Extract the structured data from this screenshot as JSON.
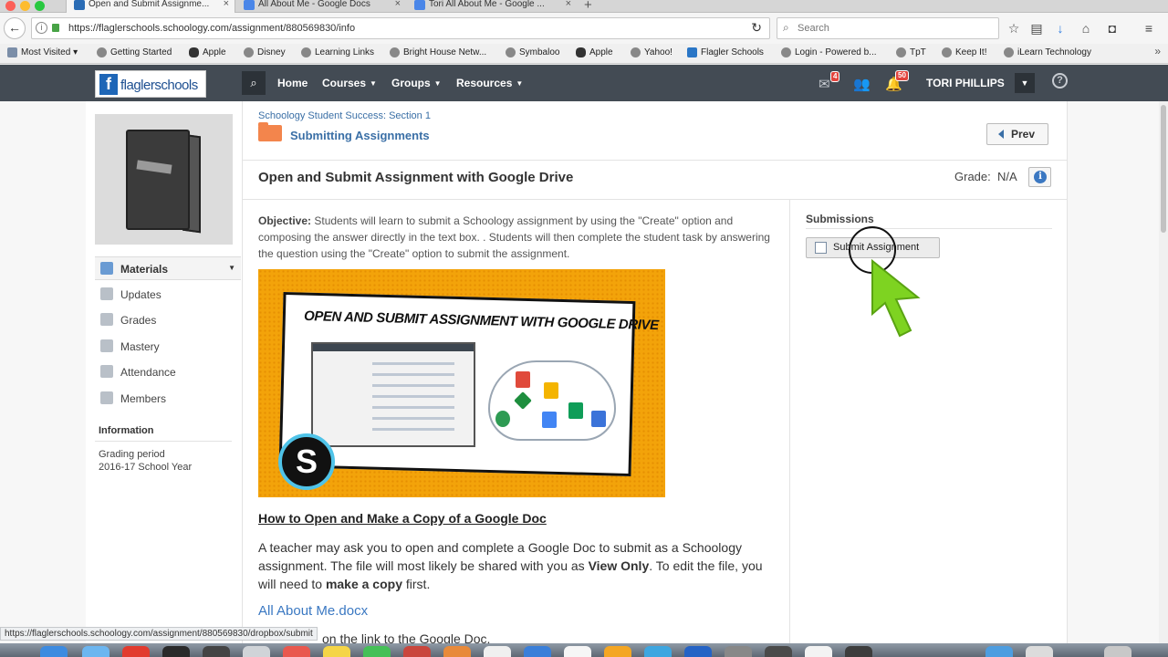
{
  "browser": {
    "tabs": [
      {
        "title": "Open and Submit Assignme..."
      },
      {
        "title": "All About Me - Google Docs"
      },
      {
        "title": "Tori All About Me - Google ..."
      }
    ],
    "url": "https://flaglerschools.schoology.com/assignment/880569830/info",
    "search_placeholder": "Search",
    "bookmarks": [
      "Most Visited",
      "Getting Started",
      "Apple",
      "Disney",
      "Learning Links",
      "Bright House Netw...",
      "Symbaloo",
      "Apple",
      "Yahoo!",
      "Flagler Schools",
      "Login - Powered b...",
      "TpT",
      "Keep It!",
      "iLearn Technology"
    ],
    "status_url": "https://flaglerschools.schoology.com/assignment/880569830/dropbox/submit"
  },
  "header": {
    "logo_text": "flaglerschools",
    "nav": [
      "Home",
      "Courses",
      "Groups",
      "Resources"
    ],
    "messages_badge": "4",
    "notifications_badge": "50",
    "user_name": "TORI PHILLIPS"
  },
  "sidebar": {
    "items": [
      "Materials",
      "Updates",
      "Grades",
      "Mastery",
      "Attendance",
      "Members"
    ],
    "info_title": "Information",
    "grading_period_label": "Grading period",
    "grading_period_value": "2016-17 School Year"
  },
  "breadcrumb": {
    "course": "Schoology Student Success: Section 1",
    "folder": "Submitting Assignments",
    "prev_label": "Prev"
  },
  "assignment": {
    "title": "Open and Submit Assignment with Google Drive",
    "grade_label": "Grade:",
    "grade_value": "N/A",
    "objective_label": "Objective:",
    "objective_text": " Students will learn to submit a Schoology assignment by using the \"Create\" option and composing the answer directly in the text box. .  Students will then complete the student task by answering the question using the \"Create\" option to submit the assignment.",
    "hero_title": "OPEN AND SUBMIT ASSIGNMENT WITH GOOGLE DRIVE",
    "hero_logo": "S",
    "section_heading": "How to Open and Make a Copy of a Google Doc",
    "para_1": "A teacher may ask you to open and complete a Google Doc to submit as a Schoology assignment.  The file will most likely be shared with you as ",
    "para_bold_1": "View Only",
    "para_2": ".  To edit the file, you will need to ",
    "para_bold_2": "make a copy",
    "para_3": " first.",
    "doc_link": "All About Me.docx",
    "partial_line": "on the link to the Google Doc."
  },
  "submissions": {
    "heading": "Submissions",
    "button_label": "Submit Assignment"
  },
  "colors": {
    "header_bg": "#434b54",
    "link_blue": "#3a6fa6",
    "folder_orange": "#f3854c",
    "cursor_green": "#7ed321"
  }
}
